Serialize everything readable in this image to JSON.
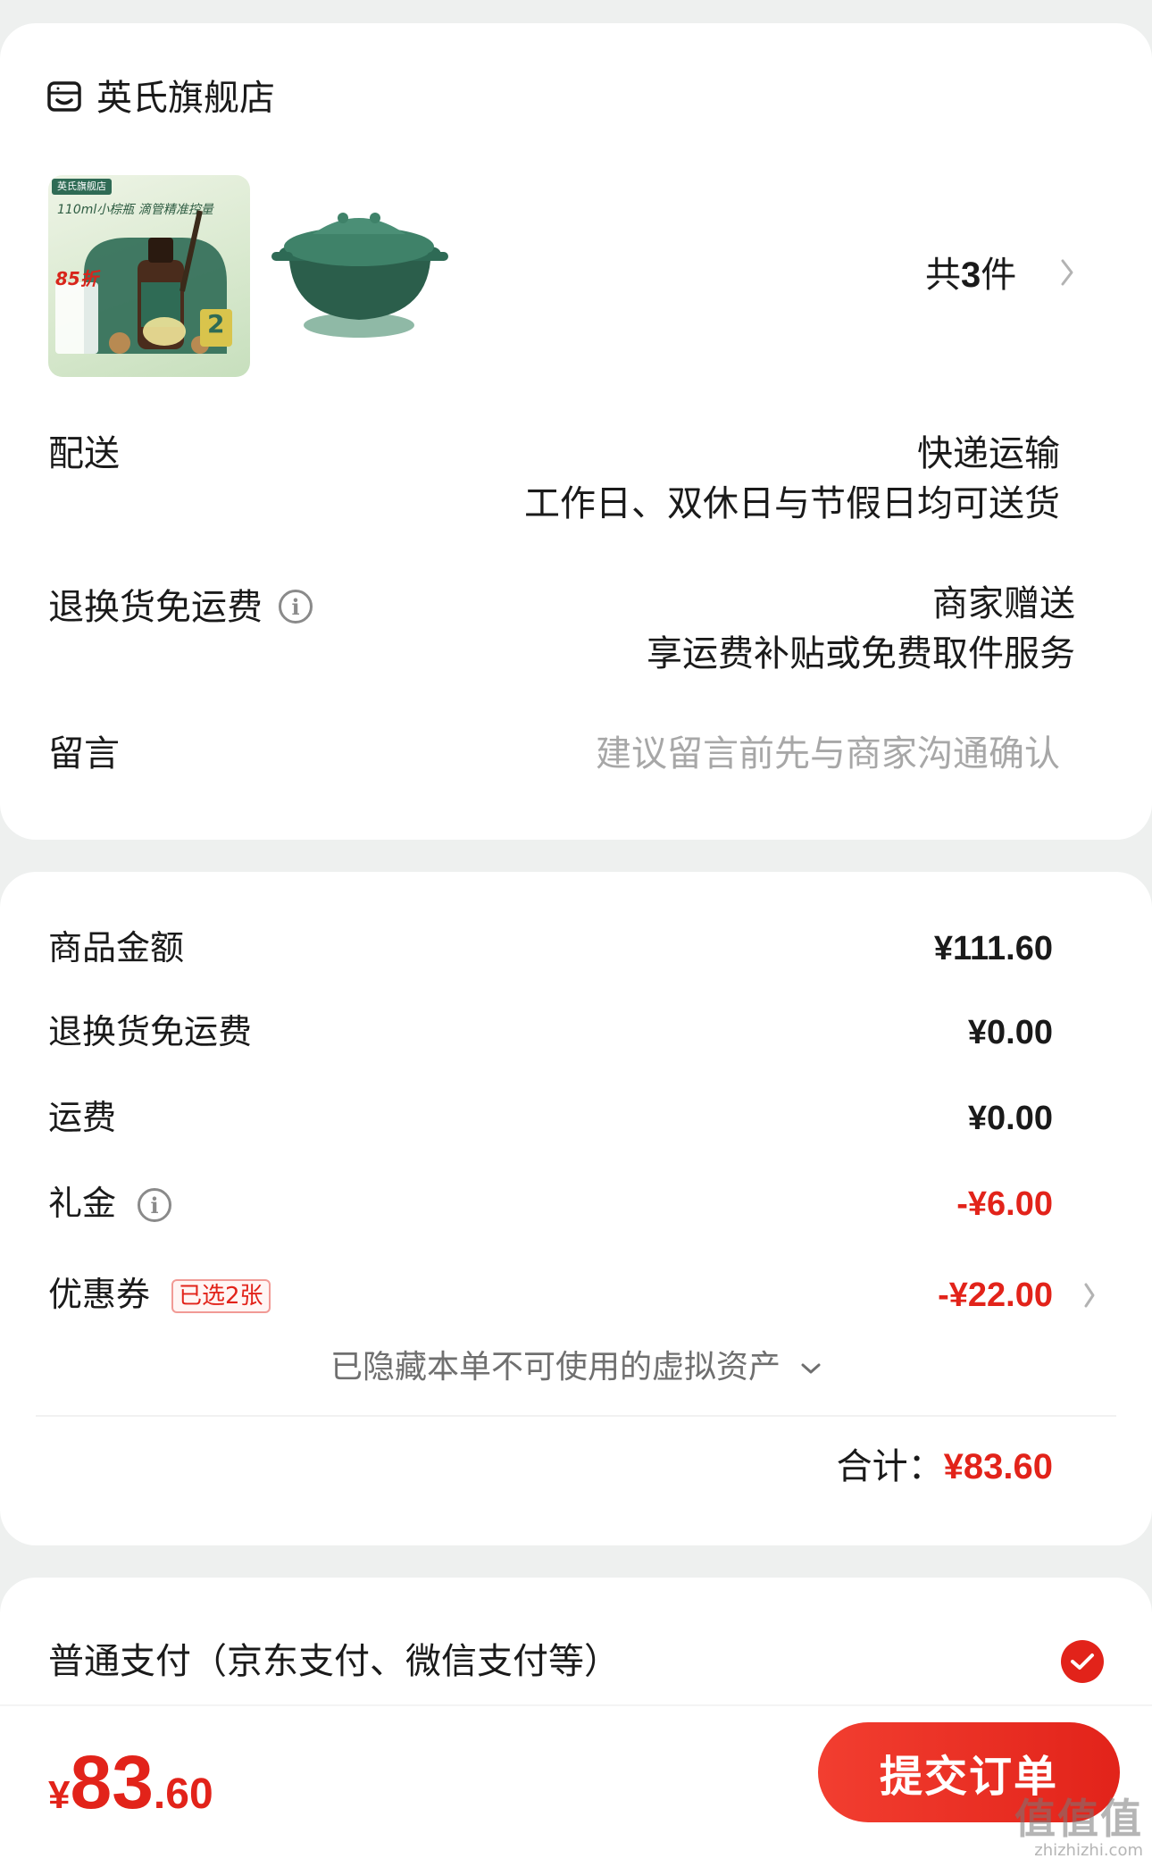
{
  "store": {
    "name": "英氏旗舰店",
    "icon": "store-icon",
    "thumbnail_1": {
      "brand_line": "英氏旗舰店",
      "headline": "110ml小棕瓶 滴管精准控量",
      "discount": "85折",
      "badge": "2"
    },
    "item_count_prefix": "共",
    "item_count": "3",
    "item_count_suffix": "件"
  },
  "delivery": {
    "label": "配送",
    "method": "快递运输",
    "note": "工作日、双休日与节假日均可送货"
  },
  "return_shipping": {
    "label": "退换货免运费",
    "value": "商家赠送",
    "note": "享运费补贴或免费取件服务"
  },
  "message": {
    "label": "留言",
    "placeholder": "建议留言前先与商家沟通确认"
  },
  "amounts": {
    "goods_label": "商品金额",
    "goods_value": "¥111.60",
    "return_label": "退换货免运费",
    "return_value": "¥0.00",
    "shipping_label": "运费",
    "shipping_value": "¥0.00",
    "gift_label": "礼金",
    "gift_value": "-¥6.00",
    "coupon_label": "优惠券",
    "coupon_tag": "已选2张",
    "coupon_value": "-¥22.00",
    "hidden_assets": "已隐藏本单不可使用的虚拟资产",
    "total_label": "合计：",
    "total_value": "¥83.60"
  },
  "payment": {
    "method": "普通支付（京东支付、微信支付等）",
    "selected": true
  },
  "footer": {
    "currency": "¥",
    "price_int": "83",
    "price_dec": ".60",
    "submit_label": "提交订单"
  },
  "watermark": {
    "logo": "值值值",
    "url": "zhizhizhi.com"
  },
  "colors": {
    "accent": "#e2231a",
    "background": "#eef0ef",
    "card": "#ffffff",
    "product_green": "#2f6b55"
  }
}
